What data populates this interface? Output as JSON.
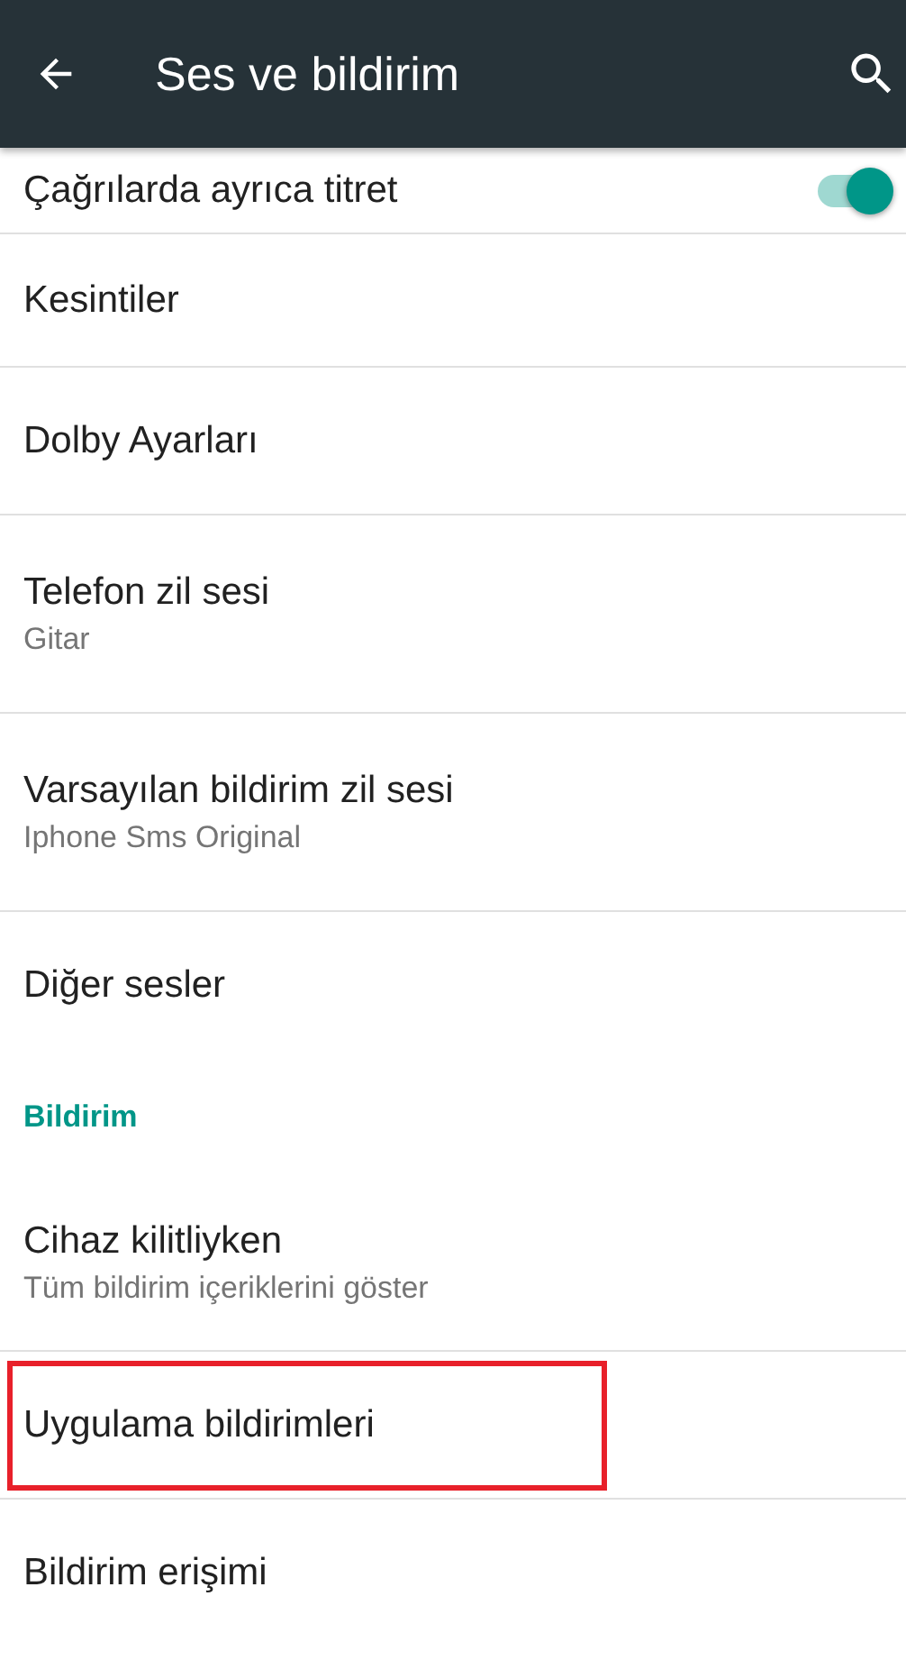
{
  "app_bar": {
    "title": "Ses ve bildirim"
  },
  "items": [
    {
      "kind": "toggle",
      "title": "Çağrılarda ayrıca titret",
      "on": true
    },
    {
      "kind": "item",
      "title": "Kesintiler"
    },
    {
      "kind": "item",
      "title": "Dolby Ayarları"
    },
    {
      "kind": "item",
      "title": "Telefon zil sesi",
      "summary": "Gitar"
    },
    {
      "kind": "item",
      "title": "Varsayılan bildirim zil sesi",
      "summary": "Iphone Sms Original"
    },
    {
      "kind": "item",
      "title": "Diğer sesler"
    },
    {
      "kind": "header",
      "title": "Bildirim"
    },
    {
      "kind": "item",
      "title": "Cihaz kilitliyken",
      "summary": "Tüm bildirim içeriklerini göster"
    },
    {
      "kind": "item",
      "title": "Uygulama bildirimleri",
      "highlighted": true
    },
    {
      "kind": "item",
      "title": "Bildirim erişimi"
    }
  ]
}
